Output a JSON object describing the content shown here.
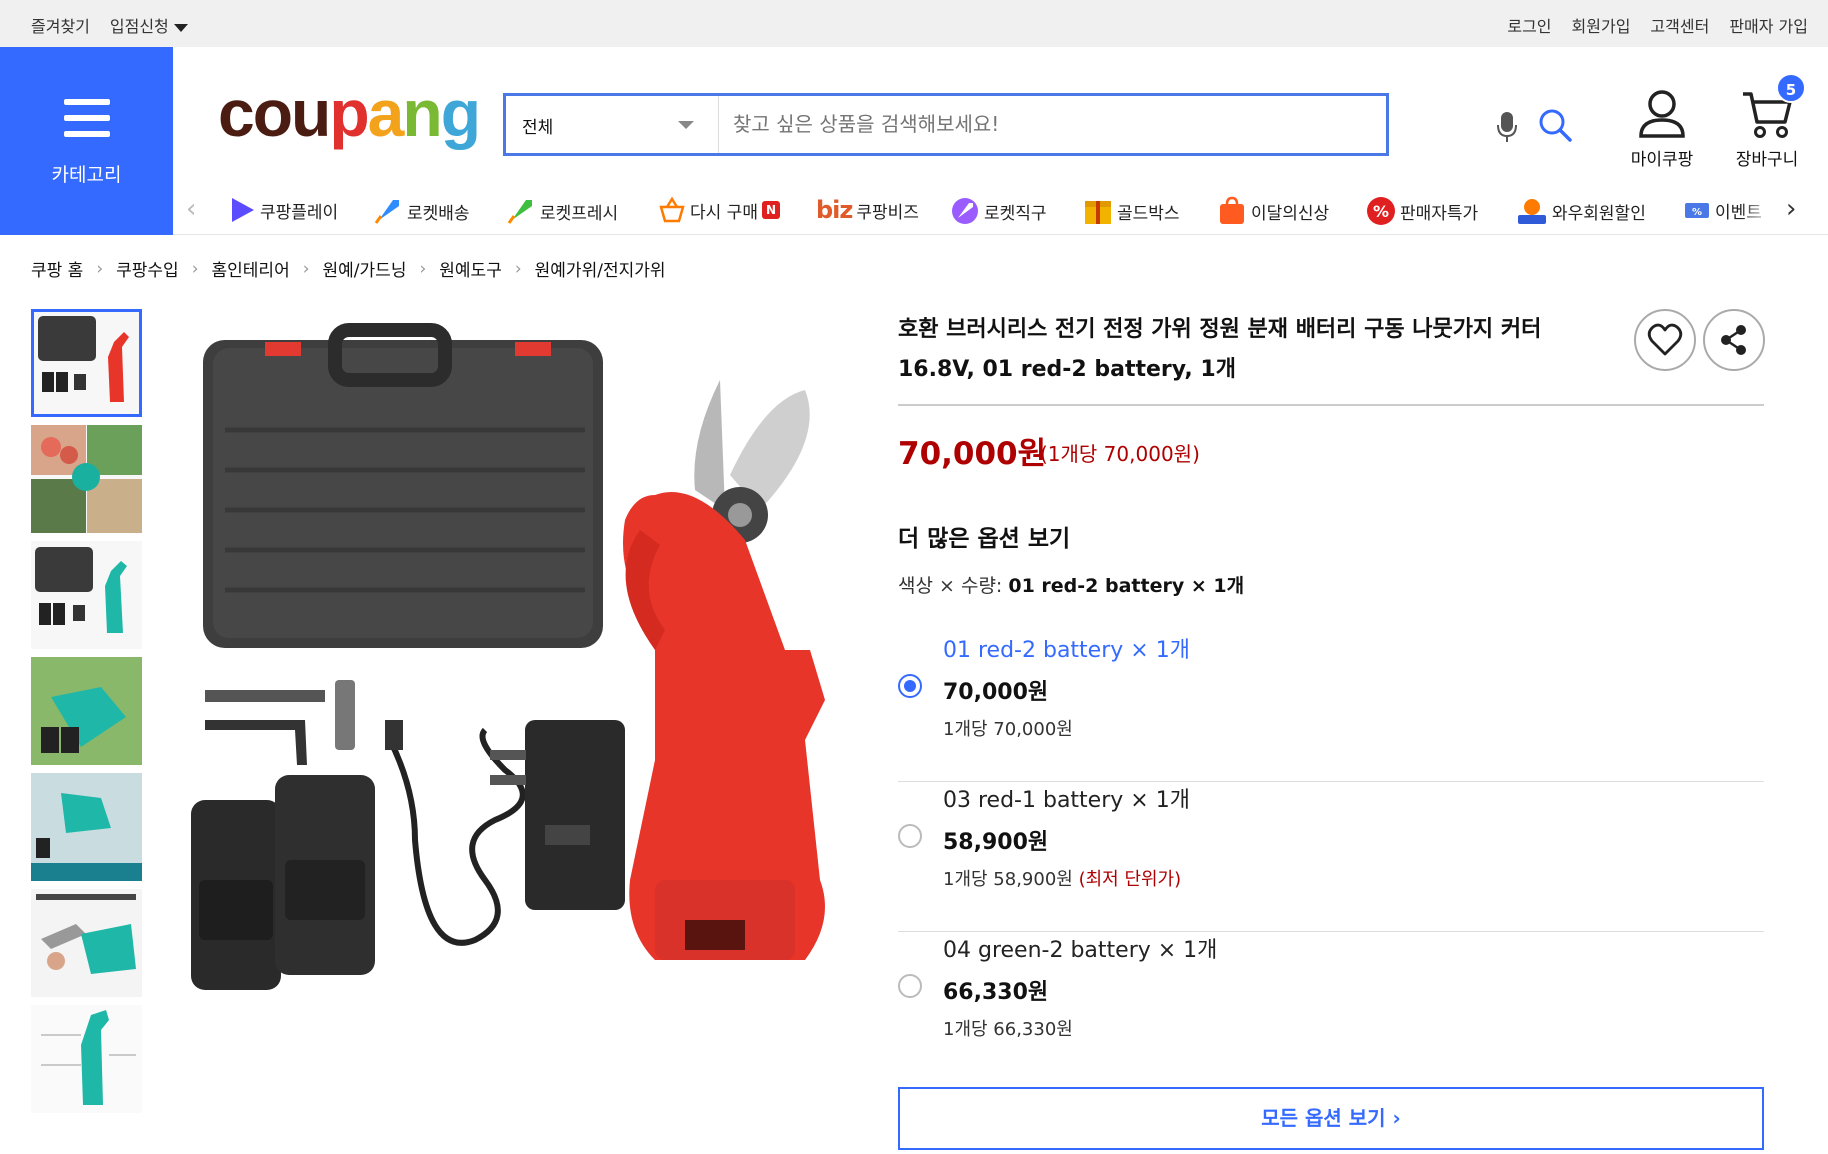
{
  "topbar": {
    "left": [
      "즐겨찾기",
      "입점신청"
    ],
    "right": [
      "로그인",
      "회원가입",
      "고객센터",
      "판매자 가입"
    ]
  },
  "category": {
    "label": "카테고리"
  },
  "logo": {
    "text": "coupang"
  },
  "search": {
    "scope": "전체",
    "placeholder": "찾고 싶은 상품을 검색해보세요!"
  },
  "header": {
    "mycoupang": "마이쿠팡",
    "cart": "장바구니",
    "cart_count": "5"
  },
  "nav": {
    "items": [
      {
        "label": "쿠팡플레이",
        "icon": "play-icon",
        "color": "#5b4dff"
      },
      {
        "label": "로켓배송",
        "icon": "rocket-icon",
        "color": "#2f8cff"
      },
      {
        "label": "로켓프레시",
        "icon": "rocket-fresh-icon",
        "color": "#3fbf3f"
      },
      {
        "label": "다시 구매",
        "icon": "basket-icon",
        "color": "#ff7a00"
      },
      {
        "label": "쿠팡비즈",
        "icon": "biz-icon",
        "color": "#e05a2a"
      },
      {
        "label": "로켓직구",
        "icon": "rocket-global-icon",
        "color": "#9b5cff"
      },
      {
        "label": "골드박스",
        "icon": "gold-box-icon",
        "color": "#f2b300"
      },
      {
        "label": "이달의신상",
        "icon": "new-bag-icon",
        "color": "#ff5a1f"
      },
      {
        "label": "판매자특가",
        "icon": "percent-icon",
        "color": "#e02020"
      },
      {
        "label": "와우회원할인",
        "icon": "wow-icon",
        "color": "#ff7a00"
      },
      {
        "label": "이벤트",
        "icon": "event-icon",
        "color": "#4a78e6"
      }
    ],
    "new_badge": "N",
    "biz_prefix": "biz"
  },
  "breadcrumbs": [
    "쿠팡 홈",
    "쿠팡수입",
    "홈인테리어",
    "원예/가드닝",
    "원예도구",
    "원예가위/전지가위"
  ],
  "product": {
    "title_line1": "호환 브러시리스 전기 전정 가위 정원 분재 배터리 구동 나뭇가지 커터",
    "title_line2": "16.8V, 01 red-2 battery, 1개",
    "price": "70,000원",
    "unit_price": "(1개당 70,000원)",
    "more_options": "더 많은 옵션 보기",
    "color_qty_label": "색상 × 수량:",
    "color_qty_value": "01 red-2 battery × 1개",
    "all_options_label": "모든 옵션 보기"
  },
  "options": [
    {
      "name": "01 red-2 battery × 1개",
      "price": "70,000원",
      "unit": "1개당 70,000원",
      "note": "",
      "selected": true
    },
    {
      "name": "03 red-1 battery × 1개",
      "price": "58,900원",
      "unit": "1개당 58,900원",
      "note": "(최저 단위가)",
      "selected": false
    },
    {
      "name": "04 green-2 battery × 1개",
      "price": "66,330원",
      "unit": "1개당 66,330원",
      "note": "",
      "selected": false
    }
  ],
  "colors": {
    "accent": "#346aff",
    "price_red": "#ae0000"
  }
}
